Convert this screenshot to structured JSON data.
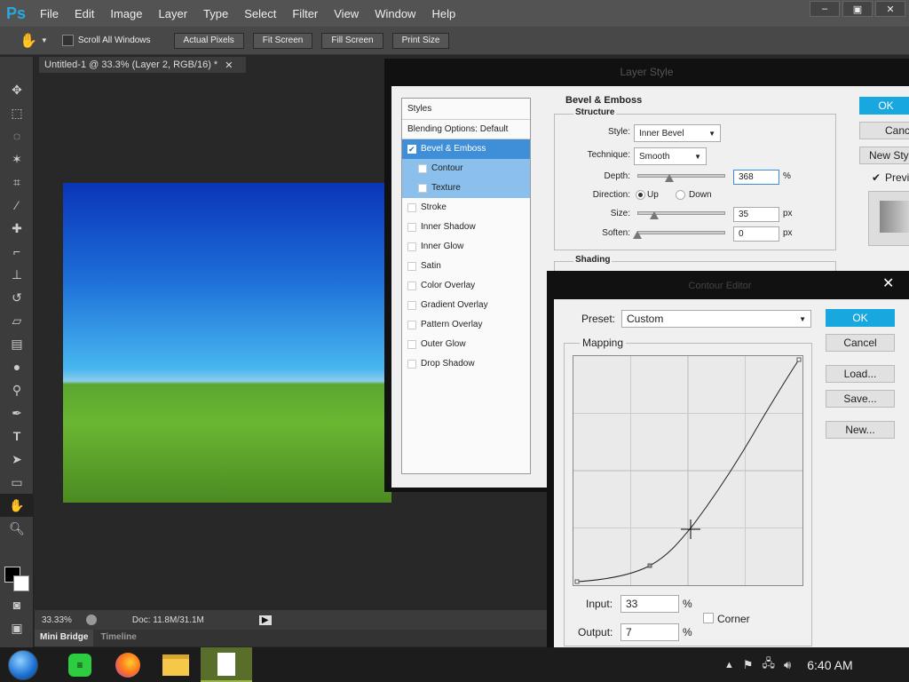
{
  "app": {
    "logo": "Ps",
    "menu": [
      "File",
      "Edit",
      "Image",
      "Layer",
      "Type",
      "Select",
      "Filter",
      "View",
      "Window",
      "Help"
    ],
    "win_buttons": [
      "–",
      "▣",
      "✕"
    ]
  },
  "options": {
    "scroll_all": "Scroll All Windows",
    "buttons": [
      "Actual Pixels",
      "Fit Screen",
      "Fill Screen",
      "Print Size"
    ]
  },
  "document": {
    "tab": "Untitled-1 @ 33.3% (Layer 2, RGB/16) *",
    "zoom": "33.33%",
    "doc": "Doc: 11.8M/31.1M"
  },
  "bottom_tabs": [
    "Mini Bridge",
    "Timeline"
  ],
  "layer_style": {
    "title": "Layer Style",
    "styles_header": "Styles",
    "blending": "Blending Options: Default",
    "items": [
      "Bevel & Emboss",
      "Contour",
      "Texture",
      "Stroke",
      "Inner Shadow",
      "Inner Glow",
      "Satin",
      "Color Overlay",
      "Gradient Overlay",
      "Pattern Overlay",
      "Outer Glow",
      "Drop Shadow"
    ],
    "section": "Bevel & Emboss",
    "structure": "Structure",
    "style_label": "Style:",
    "style_value": "Inner Bevel",
    "technique_label": "Technique:",
    "technique_value": "Smooth",
    "depth_label": "Depth:",
    "depth_value": "368",
    "depth_unit": "%",
    "direction_label": "Direction:",
    "dir_up": "Up",
    "dir_down": "Down",
    "size_label": "Size:",
    "size_value": "35",
    "size_unit": "px",
    "soften_label": "Soften:",
    "soften_value": "0",
    "soften_unit": "px",
    "shading": "Shading",
    "ok": "OK",
    "cancel": "Cancel",
    "new_style": "New Style...",
    "preview": "Preview"
  },
  "contour_editor": {
    "title": "Contour Editor",
    "preset_label": "Preset:",
    "preset_value": "Custom",
    "mapping": "Mapping",
    "input_label": "Input:",
    "input_value": "33",
    "input_unit": "%",
    "output_label": "Output:",
    "output_value": "7",
    "output_unit": "%",
    "corner": "Corner",
    "ok": "OK",
    "cancel": "Cancel",
    "load": "Load...",
    "save": "Save...",
    "new": "New..."
  },
  "taskbar": {
    "time": "6:40 AM"
  }
}
